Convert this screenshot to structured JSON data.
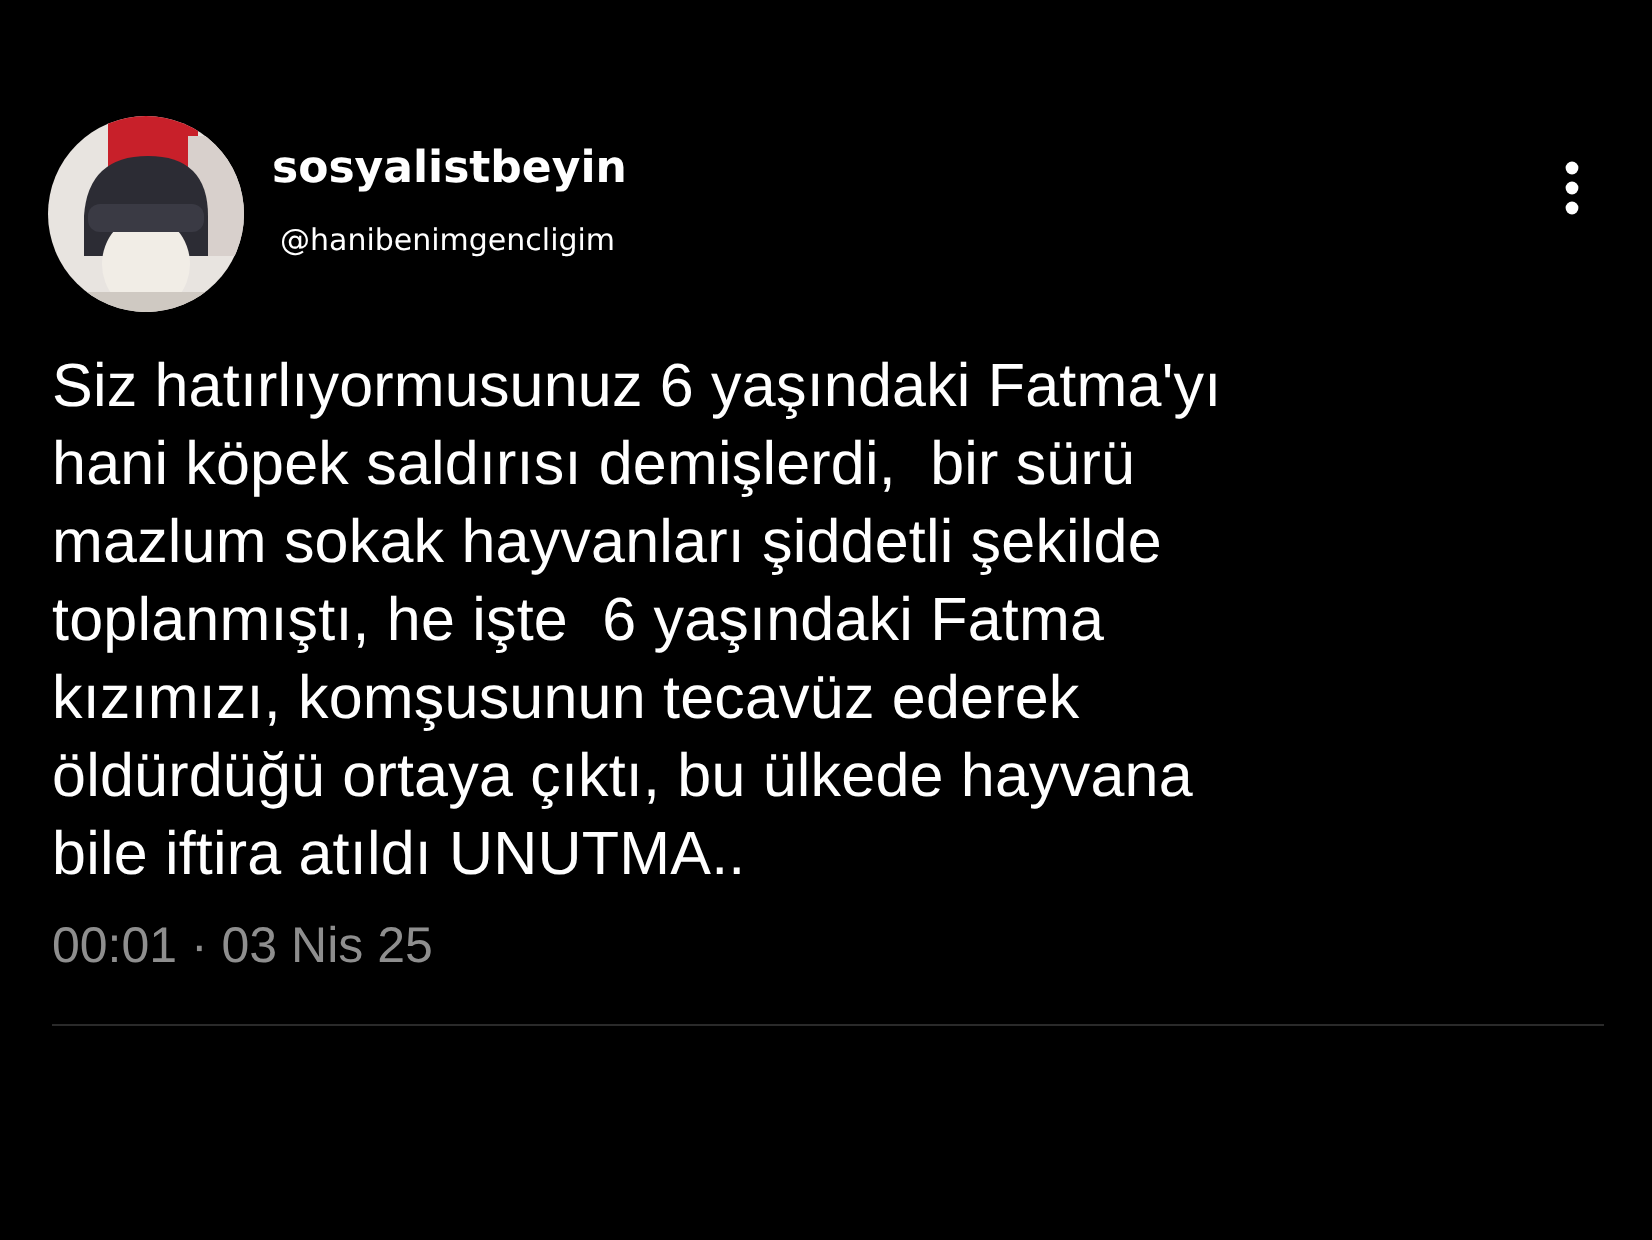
{
  "author": {
    "name": "sosyalistbeyin",
    "handle": "@hanibenimgencligim"
  },
  "body": "Siz hatırlıyormusunuz 6 yaşındaki Fatma'yı\nhani köpek saldırısı demişlerdi,  bir sürü\nmazlum sokak hayvanları şiddetli şekilde\ntoplanmıştı, he işte  6 yaşındaki Fatma\nkızımızı, komşusunun tecavüz ederek\nöldürdüğü ortaya çıktı, bu ülkede hayvana\nbile iftira atıldı UNUTMA..",
  "timestamp": "00:01 · 03 Nis 25"
}
